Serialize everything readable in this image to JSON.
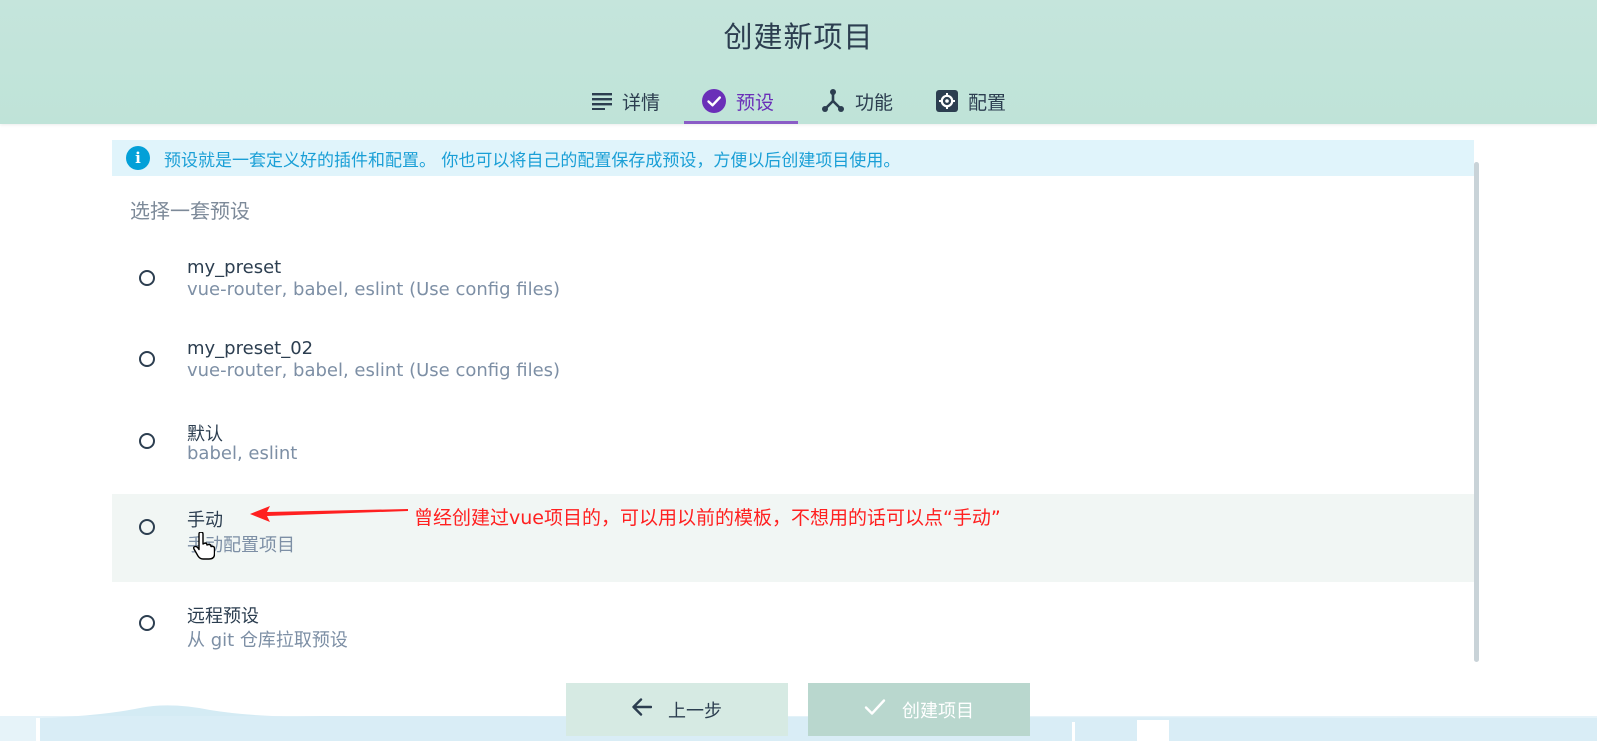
{
  "header": {
    "title": "创建新项目",
    "tabs": [
      {
        "label": "详情",
        "icon": "list-icon",
        "active": false
      },
      {
        "label": "预设",
        "icon": "check-circle-icon",
        "active": true
      },
      {
        "label": "功能",
        "icon": "branch-icon",
        "active": false
      },
      {
        "label": "配置",
        "icon": "gear-icon",
        "active": false
      }
    ]
  },
  "info": {
    "icon": "info-icon",
    "text": "预设就是一套定义好的插件和配置。 你也可以将自己的配置保存成预设，方便以后创建项目使用。"
  },
  "section": {
    "title": "选择一套预设"
  },
  "presets": [
    {
      "name": "my_preset",
      "description": "vue-router, babel, eslint (Use config files)",
      "selected": false
    },
    {
      "name": "my_preset_02",
      "description": "vue-router, babel, eslint (Use config files)",
      "selected": false
    },
    {
      "name": "默认",
      "description": "babel, eslint",
      "selected": false
    },
    {
      "name": "手动",
      "description": "手动配置项目",
      "selected": false
    },
    {
      "name": "远程预设",
      "description": "从 git 仓库拉取预设",
      "selected": false
    }
  ],
  "annotation": {
    "text": "曾经创建过vue项目的，可以用以前的模板，不想用的话可以点“手动”",
    "color": "#ff2020"
  },
  "buttons": {
    "prev_label": "上一步",
    "create_label": "创建项目"
  },
  "colors": {
    "header_bg": "#c5e5dc",
    "accent": "#6a2fb8",
    "info_bg": "#e0f4fb",
    "info_text": "#1a9fd6"
  }
}
